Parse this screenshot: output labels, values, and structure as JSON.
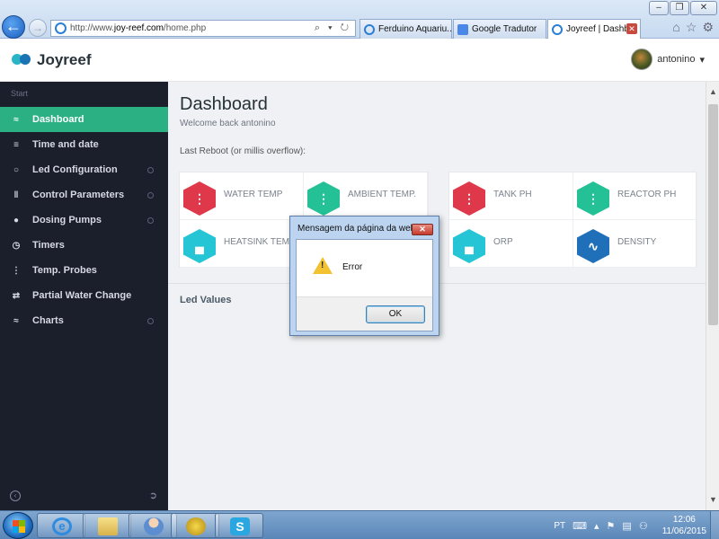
{
  "browser": {
    "url_prefix": "http://www.",
    "url_domain": "joy-reef.com",
    "url_path": "/home.php",
    "addr_tools": "⌕ ▾ ↻",
    "tabs": [
      {
        "label": "Ferduino Aquariu..."
      },
      {
        "label": "Google Tradutor"
      },
      {
        "label": "Joyreef | Dashb..."
      }
    ],
    "window_buttons": [
      "‒",
      "❐",
      "✕"
    ]
  },
  "header": {
    "brand": "Joyreef",
    "user_name": "antonino",
    "caret": "▾"
  },
  "sidebar": {
    "section_label": "Start",
    "items": [
      {
        "label": "Dashboard",
        "icon": "≈",
        "active": true
      },
      {
        "label": "Time and date",
        "icon": "≡"
      },
      {
        "label": "Led Configuration",
        "icon": "○"
      },
      {
        "label": "Control Parameters",
        "icon": "‖"
      },
      {
        "label": "Dosing Pumps",
        "icon": "●"
      },
      {
        "label": "Timers",
        "icon": "◷"
      },
      {
        "label": "Temp. Probes",
        "icon": "⋮"
      },
      {
        "label": "Partial Water Change",
        "icon": "⇄"
      },
      {
        "label": "Charts",
        "icon": "≈"
      }
    ]
  },
  "main": {
    "title": "Dashboard",
    "welcome": "Welcome back antonino",
    "reboot": "Last Reboot (or millis overflow):",
    "tiles_left": [
      {
        "label": "WATER TEMP",
        "color": "red",
        "glyph": "⋮"
      },
      {
        "label": "AMBIENT TEMP.",
        "color": "green",
        "glyph": "⋮"
      },
      {
        "label": "HEATSINK TEMP.",
        "color": "cyan",
        "glyph": "▄"
      }
    ],
    "tiles_right": [
      {
        "label": "TANK PH",
        "color": "red",
        "glyph": "⋮"
      },
      {
        "label": "REACTOR PH",
        "color": "green",
        "glyph": "⋮"
      },
      {
        "label": "ORP",
        "color": "cyan",
        "glyph": "▄"
      },
      {
        "label": "DENSITY",
        "color": "blue",
        "glyph": "∿"
      }
    ],
    "led_values": "Led Values"
  },
  "dialog": {
    "title": "Mensagem da página da web",
    "message": "Error",
    "ok": "OK",
    "close": "✕"
  },
  "taskbar": {
    "lang": "PT",
    "time": "12:06",
    "date": "11/06/2015"
  }
}
